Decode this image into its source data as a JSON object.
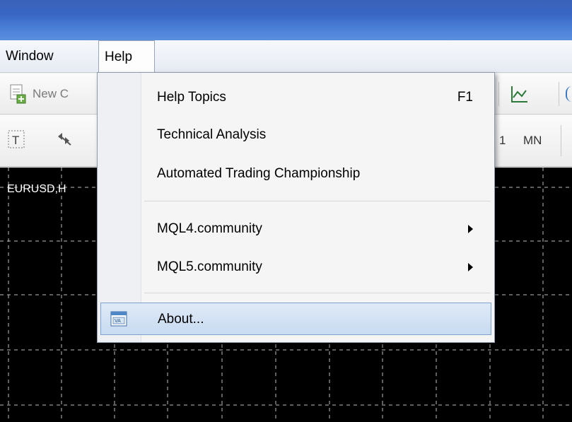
{
  "menubar": {
    "window": "Window",
    "help": "Help"
  },
  "toolbar": {
    "new_chart_label": "New C",
    "period_1": "1",
    "period_mn": "MN"
  },
  "chart": {
    "symbol_label": "EURUSD,H"
  },
  "help_menu": {
    "items": [
      {
        "label": "Help Topics",
        "shortcut": "F1"
      },
      {
        "label": "Technical Analysis"
      },
      {
        "label": "Automated Trading Championship"
      },
      {
        "label": "MQL4.community",
        "submenu": true
      },
      {
        "label": "MQL5.community",
        "submenu": true
      },
      {
        "label": "About...",
        "highlighted": true
      }
    ]
  },
  "icons": {
    "new_chart": "new-chart-icon",
    "text_tool": "text-tool-icon",
    "arrows_tool": "arrows-tool-icon",
    "indicator": "indicator-icon",
    "about": "about-window-icon"
  },
  "colors": {
    "highlight": "#c8dbf1",
    "title_bar": "#3966c4",
    "chart_bg": "#000000"
  }
}
